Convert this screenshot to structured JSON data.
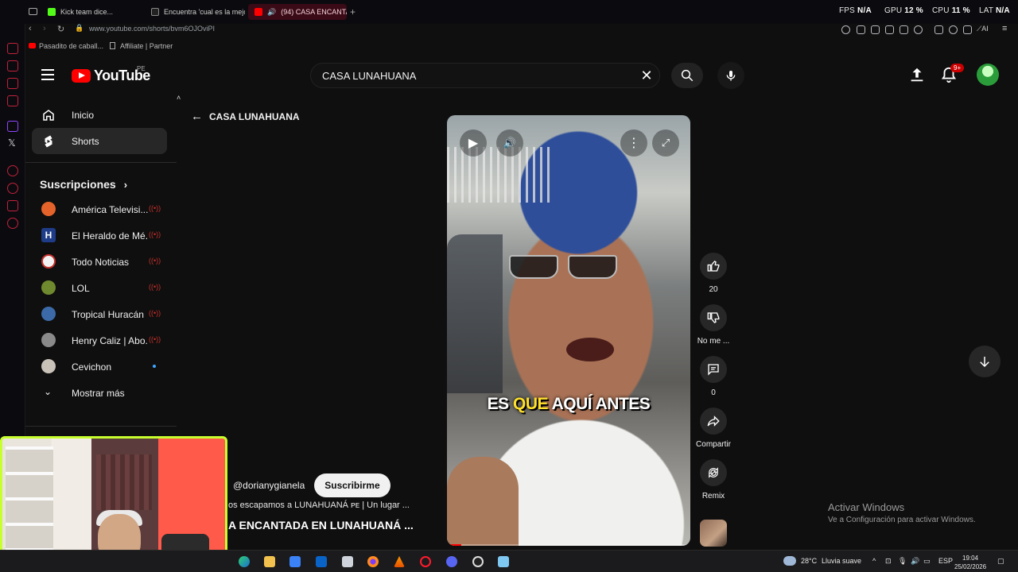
{
  "browser": {
    "tabs": [
      {
        "label": "Kick team dice..."
      },
      {
        "label": "Encuentra 'cual es la mejo"
      },
      {
        "label": "(94) CASA ENCANTAD"
      }
    ],
    "url": "www.youtube.com/shorts/bvm6OJOviPI",
    "bookmarks": [
      "Pasadito de caball...",
      "Affiliate | Partner"
    ],
    "perf": {
      "fps_label": "FPS",
      "fps_value": "N/A",
      "gpu_label": "GPU",
      "gpu_value": "12 %",
      "cpu_label": "CPU",
      "cpu_value": "11 %",
      "lat_label": "LAT",
      "lat_value": "N/A"
    }
  },
  "youtube": {
    "logo_text": "YouTube",
    "country_code": "PE",
    "search": {
      "value": "CASA LUNAHUANA"
    },
    "notification_count": "9+",
    "sidebar": {
      "items": [
        {
          "label": "Inicio",
          "icon": "home-icon"
        },
        {
          "label": "Shorts",
          "icon": "shorts-icon"
        }
      ],
      "subscriptions_heading": "Suscripciones",
      "subscriptions": [
        {
          "name": "América Televisi...",
          "live": true,
          "avatar_color": "#e4632a"
        },
        {
          "name": "El Heraldo de Mé...",
          "live": true,
          "avatar_color": "#1f3c88"
        },
        {
          "name": "Todo Noticias",
          "live": true,
          "avatar_color": "#f2f2f2"
        },
        {
          "name": "LOL",
          "live": true,
          "avatar_color": "#6f8a2e"
        },
        {
          "name": "Tropical Huracán",
          "live": true,
          "avatar_color": "#3c6aa8"
        },
        {
          "name": "Henry Caliz | Abo...",
          "live": true,
          "avatar_color": "#8a8a8a"
        },
        {
          "name": "Cevichon",
          "live": false,
          "new_content": true,
          "avatar_color": "#c9c2b8"
        }
      ],
      "show_more": "Mostrar más"
    },
    "shorts": {
      "back_label": "CASA LUNAHUANA",
      "caption": {
        "before": "ES ",
        "highlight": "QUE",
        "after": " AQUÍ ANTES"
      },
      "channel": "@dorianygianela",
      "subscribe_label": "Suscribirme",
      "description": "os escapamos a LUNAHUANÁ ᴘᴇ | Un lugar ...",
      "title": "A ENCANTADA EN LUNAHUANÁ ...",
      "actions": {
        "likes": "20",
        "dislike_label": "No me ...",
        "comments": "0",
        "share_label": "Compartir",
        "remix_label": "Remix"
      }
    }
  },
  "windows_watermark": {
    "line1": "Activar Windows",
    "line2": "Ve a Configuración para activar Windows."
  },
  "taskbar": {
    "weather": "28°C",
    "weather_desc": "Lluvia suave",
    "language": "ESP",
    "time": "19:04",
    "date": "25/02/2026"
  }
}
